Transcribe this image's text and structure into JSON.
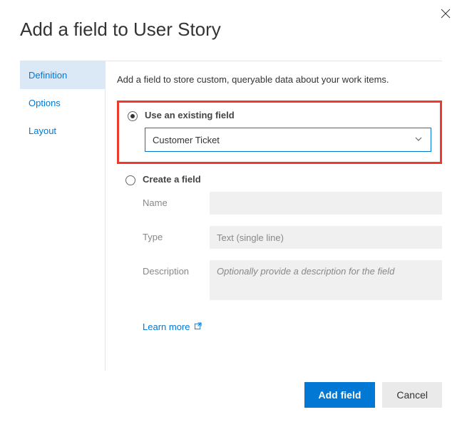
{
  "title": "Add a field to User Story",
  "sidebar": {
    "items": [
      {
        "label": "Definition"
      },
      {
        "label": "Options"
      },
      {
        "label": "Layout"
      }
    ]
  },
  "content": {
    "description": "Add a field to store custom, queryable data about your work items.",
    "existing": {
      "label": "Use an existing field",
      "selected": "Customer Ticket"
    },
    "create": {
      "label": "Create a field",
      "name_label": "Name",
      "name_value": "",
      "type_label": "Type",
      "type_value": "Text (single line)",
      "description_label": "Description",
      "description_placeholder": "Optionally provide a description for the field"
    },
    "learn_more": "Learn more"
  },
  "footer": {
    "primary": "Add field",
    "secondary": "Cancel"
  }
}
